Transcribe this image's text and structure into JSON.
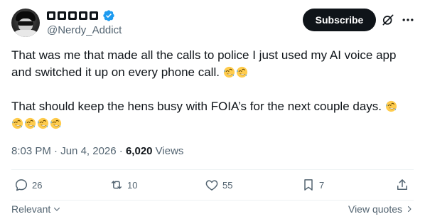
{
  "author": {
    "display_name_glyphs": [
      "glyph",
      "glyph",
      "glyph",
      "glyph",
      "glyph"
    ],
    "verified_icon": "verified-badge-icon",
    "handle": "@Nerdy_Addict"
  },
  "header": {
    "subscribe_label": "Subscribe",
    "grok_icon": "grok-icon",
    "more_icon": "more-icon"
  },
  "tweet": {
    "line1": "That was me that made all the calls to police I just used my AI voice app and switched it up on every phone call. ",
    "line2": "That should keep the hens busy with FOIA’s for the next couple days. ",
    "emoji": "rolling-on-floor-laughing-emoji"
  },
  "meta": {
    "time": "8:03 PM",
    "separator": " · ",
    "date": "Jun 4, 2026",
    "views_count": "6,020",
    "views_label": " Views"
  },
  "actions": {
    "replies": "26",
    "reposts": "10",
    "likes": "55",
    "bookmarks": "7"
  },
  "footer": {
    "sort_label": "Relevant",
    "view_quotes_label": "View quotes"
  },
  "colors": {
    "text": "#0f1419",
    "secondary": "#536471",
    "verified": "#1d9bf0",
    "divider": "#eff3f4"
  }
}
